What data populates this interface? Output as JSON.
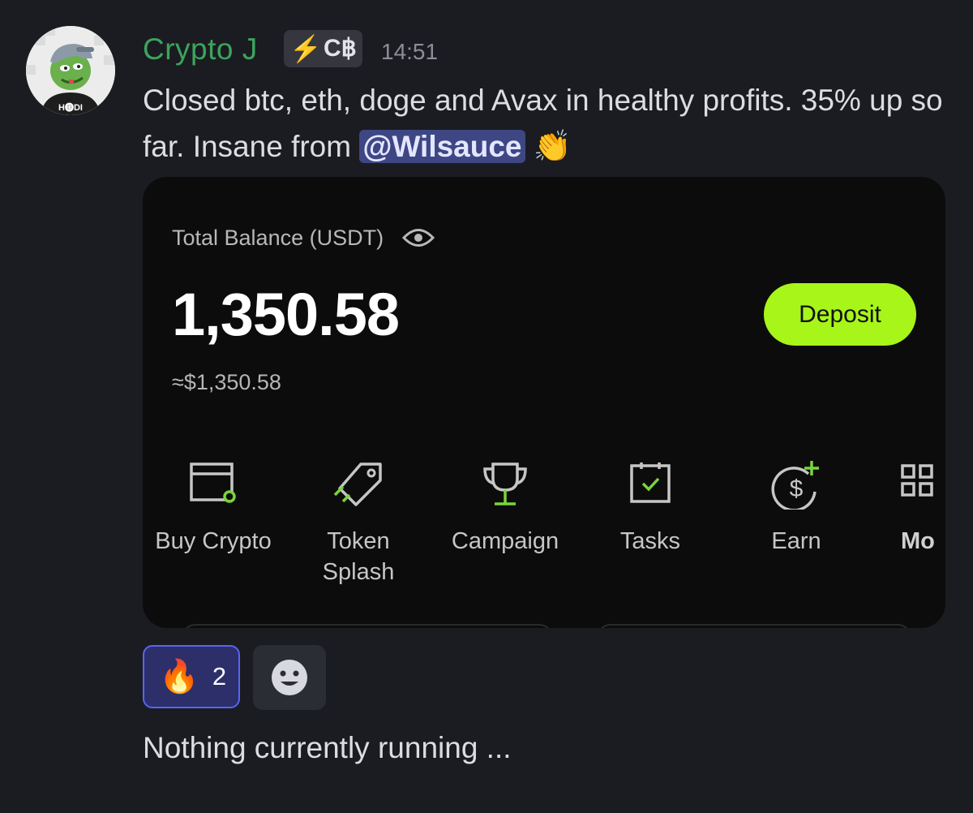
{
  "message": {
    "author": "Crypto J",
    "tag": {
      "symbol": "⚡",
      "text": "C฿"
    },
    "timestamp": "14:51",
    "text_before": "Closed btc, eth, doge and Avax in healthy profits. 35% up so far. Insane from ",
    "mention": "@Wilsauce",
    "emoji": "👏",
    "avatar_badge_text": "H🅓DI"
  },
  "card": {
    "balance_label": "Total Balance (USDT)",
    "balance_value": "1,350.58",
    "balance_usd": "≈$1,350.58",
    "deposit_label": "Deposit",
    "shortcuts": [
      {
        "label": "Buy Crypto",
        "icon": "wallet-card-icon"
      },
      {
        "label": "Token Splash",
        "icon": "tag-icon"
      },
      {
        "label": "Campaign",
        "icon": "trophy-icon"
      },
      {
        "label": "Tasks",
        "icon": "task-checklist-icon"
      },
      {
        "label": "Earn",
        "icon": "earn-dollar-icon"
      },
      {
        "label": "Mo",
        "icon": "more-grid-icon"
      }
    ],
    "accent_color": "#a8f51a"
  },
  "reactions": [
    {
      "emoji": "🔥",
      "count": "2"
    }
  ],
  "status_text": "Nothing currently running ...",
  "colors": {
    "author": "#3ba55d",
    "background": "#1b1c21",
    "mention_bg": "#3e4684"
  }
}
